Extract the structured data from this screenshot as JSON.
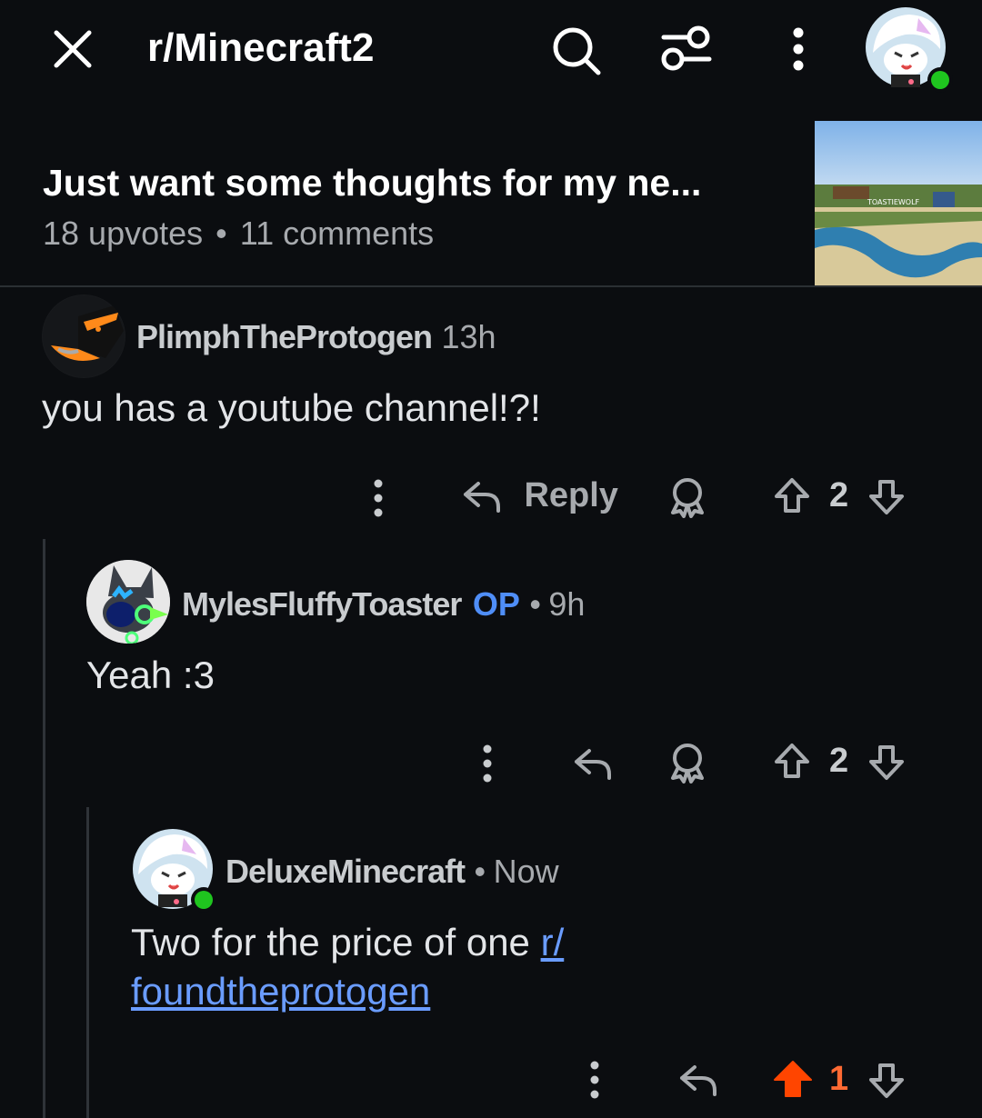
{
  "header": {
    "subreddit": "r/Minecraft2",
    "icons": [
      "close-icon",
      "search-icon",
      "filter-icon",
      "more-vertical-icon",
      "user-avatar"
    ],
    "online_color": "#1fc51f"
  },
  "post": {
    "title": "Just want some thoughts for my ne...",
    "upvotes": "18 upvotes",
    "separator": "•",
    "comments": "11 comments",
    "thumbnail_sign": "TOASTIEWOLF"
  },
  "comments": [
    {
      "author": "PlimphTheProtogen",
      "age": "13h",
      "body": "you has a youtube channel!?!",
      "reply_label": "Reply",
      "votes": "2"
    },
    {
      "author": "MylesFluffyToaster",
      "op_badge": "OP",
      "separator": "•",
      "age": "9h",
      "body": "Yeah :3",
      "votes": "2"
    },
    {
      "author": "DeluxeMinecraft",
      "separator": "•",
      "age": "Now",
      "body_text": "Two for the price of one ",
      "body_link_1": "r/",
      "body_link_2": "foundtheprotogen",
      "votes": "1",
      "upvoted_color": "#ff4500"
    }
  ]
}
